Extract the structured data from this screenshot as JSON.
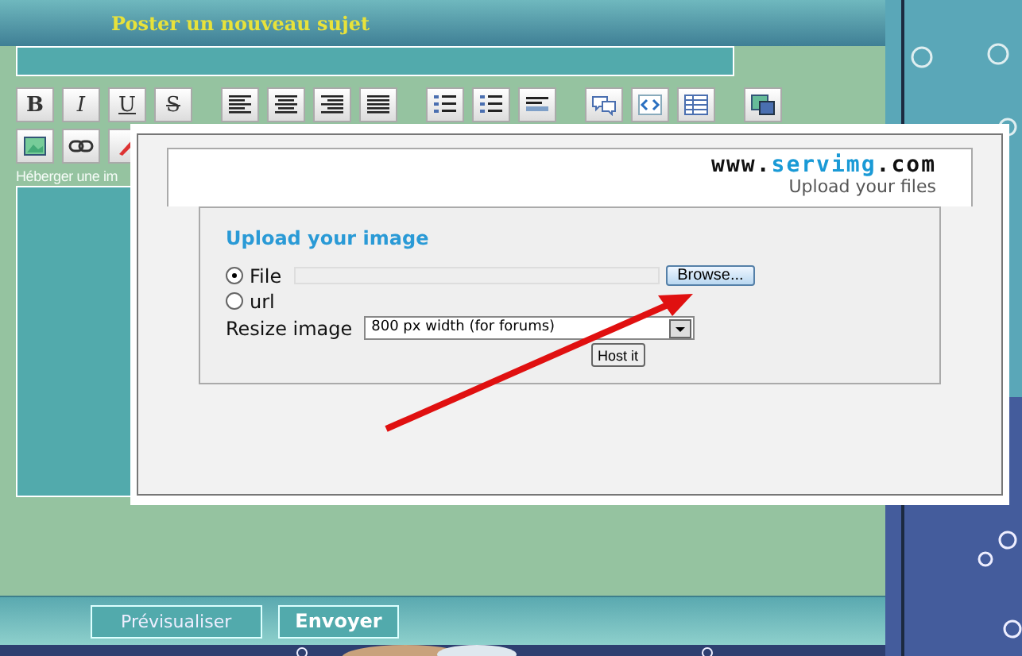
{
  "header": {
    "title": "Poster un nouveau sujet"
  },
  "format_buttons": [
    {
      "label": "B"
    },
    {
      "label": "I"
    },
    {
      "label": "U"
    },
    {
      "label": "S"
    }
  ],
  "host_hint": "Héberger une im",
  "upload_dialog": {
    "logo_parts": [
      "www.",
      "servimg",
      ".com"
    ],
    "tagline": "Upload your files",
    "heading": "Upload your image",
    "sources": [
      {
        "label": "File",
        "selected": true
      },
      {
        "label": "url",
        "selected": false
      }
    ],
    "browse_button": "Browse...",
    "resize_label": "Resize image",
    "resize_value": "800 px width (for forums)",
    "submit_button": "Host it"
  },
  "actions": [
    {
      "label": "Prévisualiser",
      "kind": "secondary"
    },
    {
      "label": "Envoyer",
      "kind": "primary"
    }
  ]
}
